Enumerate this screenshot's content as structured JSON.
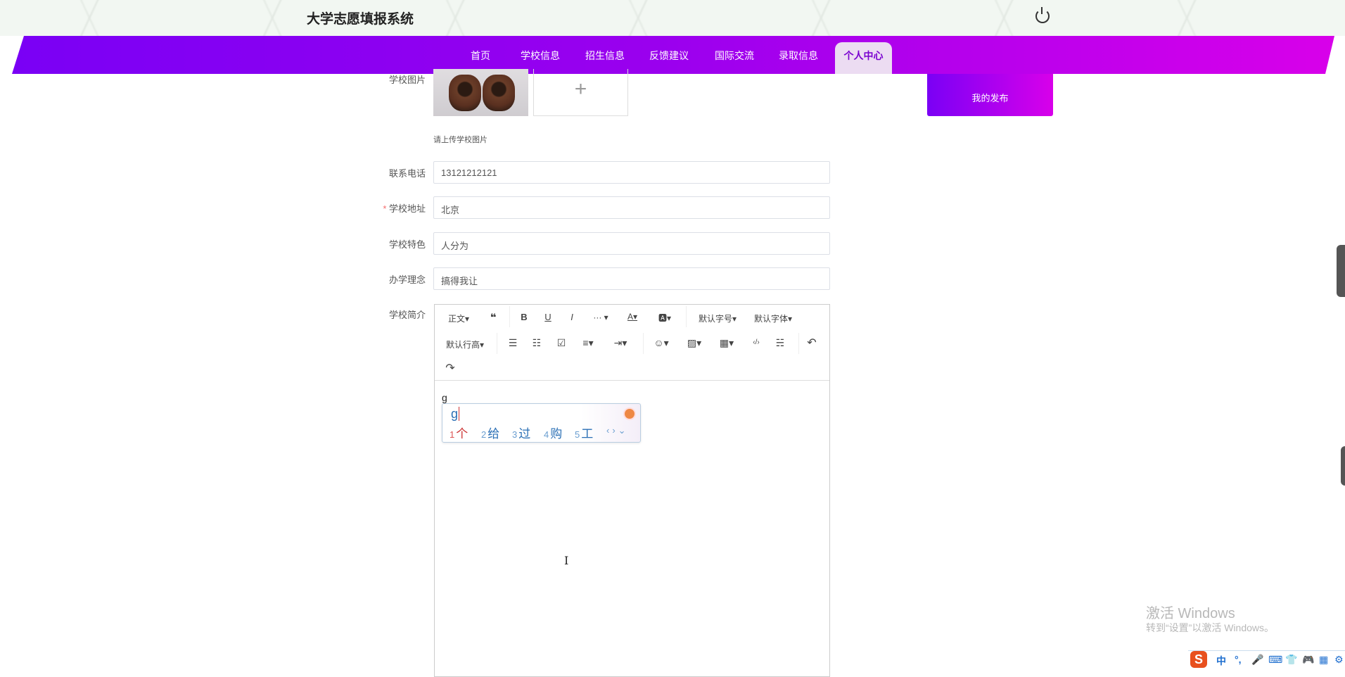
{
  "header": {
    "title": "大学志愿填报系统",
    "power_icon": "power-icon"
  },
  "nav": {
    "items": [
      "首页",
      "学校信息",
      "招生信息",
      "反馈建议",
      "国际交流",
      "录取信息"
    ],
    "active": "个人中心"
  },
  "side": {
    "my_posts": "我的发布"
  },
  "form": {
    "image_label": "学校图片",
    "upload_plus": "+",
    "upload_hint": "请上传学校图片",
    "phone_label": "联系电话",
    "phone_value": "13121212121",
    "address_label": "学校地址",
    "address_value": "北京",
    "feature_label": "学校特色",
    "feature_value": "人分为",
    "philosophy_label": "办学理念",
    "philosophy_value": "搞得我让",
    "intro_label": "学校简介"
  },
  "editor": {
    "toolbar": {
      "paragraph": "正文▾",
      "quote": "❝",
      "bold": "B",
      "underline": "U",
      "italic": "I",
      "more": "··· ▾",
      "font_color": "A▾",
      "bg_color": "🅰▾",
      "font_size": "默认字号▾",
      "font_family": "默认字体▾",
      "line_height": "默认行高▾",
      "ul": "☰",
      "ol": "☷",
      "todo": "☑",
      "align": "≡▾",
      "indent": "⇥▾",
      "emoji": "☺▾",
      "image": "▨▾",
      "table": "▦▾",
      "code": "‹/›",
      "divider": "☵",
      "undo": "↶",
      "redo": "↷"
    },
    "content": "g"
  },
  "ime": {
    "input": "g",
    "candidates": [
      {
        "n": "1",
        "c": "个"
      },
      {
        "n": "2",
        "c": "给"
      },
      {
        "n": "3",
        "c": "过"
      },
      {
        "n": "4",
        "c": "购"
      },
      {
        "n": "5",
        "c": "工"
      }
    ],
    "nav": "‹›⌄"
  },
  "watermark": {
    "line1": "激活 Windows",
    "line2": "转到“设置”以激活 Windows。"
  },
  "imebar": {
    "logo": "S",
    "mode": "中",
    "punct": "°,",
    "items": [
      "🎤",
      "⌨",
      "👕",
      "🎮",
      "▦",
      "⚙"
    ]
  }
}
